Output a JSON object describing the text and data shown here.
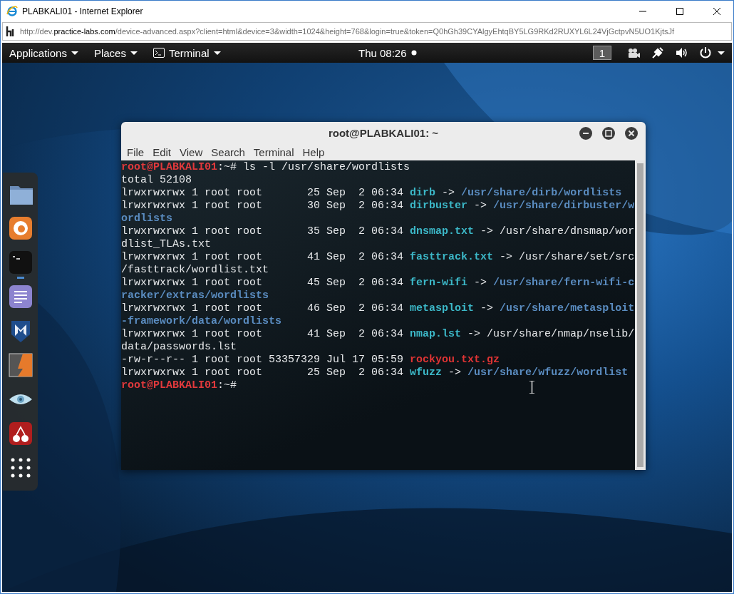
{
  "browser": {
    "title": "PLABKALI01 - Internet Explorer",
    "address": [
      {
        "text": "http://dev.",
        "kind": "dim"
      },
      {
        "text": "practice-labs.com",
        "kind": "domain"
      },
      {
        "text": "/device-advanced.aspx?client=html&device=3&width=1024&height=768&login=true&token=Q0hGh39CYAlgyEhtqBY5LG9RKd2RUXYL6L24VjGctpvN5UO1KjtsJf",
        "kind": "dim"
      }
    ]
  },
  "topbar": {
    "menus": [
      {
        "label": "Applications",
        "kind": "plain"
      },
      {
        "label": "Places",
        "kind": "plain"
      },
      {
        "label": "Terminal",
        "kind": "app"
      }
    ],
    "clock": "Thu 08:26",
    "workspace": "1"
  },
  "dock": {
    "items": [
      {
        "kind": "files",
        "running": false
      },
      {
        "kind": "browser",
        "running": false
      },
      {
        "kind": "terminal",
        "running": true
      },
      {
        "kind": "editor",
        "running": false
      },
      {
        "kind": "shield",
        "running": false
      },
      {
        "kind": "split",
        "running": false
      },
      {
        "kind": "eye",
        "running": false
      },
      {
        "kind": "cherry",
        "running": false
      },
      {
        "kind": "grid",
        "running": false
      }
    ]
  },
  "terminal": {
    "title": "root@PLABKALI01: ~",
    "menu": [
      "File",
      "Edit",
      "View",
      "Search",
      "Terminal",
      "Help"
    ],
    "lines": [
      [
        {
          "text": "root@PLABKALI01",
          "kind": "prompt"
        },
        {
          "text": ":~# ls -l /usr/share/wordlists",
          "kind": "plain"
        }
      ],
      [
        {
          "text": "total 52108",
          "kind": "plain"
        }
      ],
      [
        {
          "text": "lrwxrwxrwx 1 root root       25 Sep  2 06:34 ",
          "kind": "plain"
        },
        {
          "text": "dirb",
          "kind": "symlink"
        },
        {
          "text": " -> ",
          "kind": "plain"
        },
        {
          "text": "/usr/share/dirb/wordlists",
          "kind": "directory"
        }
      ],
      [
        {
          "text": "lrwxrwxrwx 1 root root       30 Sep  2 06:34 ",
          "kind": "plain"
        },
        {
          "text": "dirbuster",
          "kind": "symlink"
        },
        {
          "text": " -> ",
          "kind": "plain"
        },
        {
          "text": "/usr/share/dirbuster/w",
          "kind": "directory"
        }
      ],
      [
        {
          "text": "ordlists",
          "kind": "directory"
        }
      ],
      [
        {
          "text": "lrwxrwxrwx 1 root root       35 Sep  2 06:34 ",
          "kind": "plain"
        },
        {
          "text": "dnsmap.txt",
          "kind": "symlink"
        },
        {
          "text": " -> /usr/share/dnsmap/wor",
          "kind": "plain"
        }
      ],
      [
        {
          "text": "dlist_TLAs.txt",
          "kind": "plain"
        }
      ],
      [
        {
          "text": "lrwxrwxrwx 1 root root       41 Sep  2 06:34 ",
          "kind": "plain"
        },
        {
          "text": "fasttrack.txt",
          "kind": "symlink"
        },
        {
          "text": " -> /usr/share/set/src",
          "kind": "plain"
        }
      ],
      [
        {
          "text": "/fasttrack/wordlist.txt",
          "kind": "plain"
        }
      ],
      [
        {
          "text": "lrwxrwxrwx 1 root root       45 Sep  2 06:34 ",
          "kind": "plain"
        },
        {
          "text": "fern-wifi",
          "kind": "symlink"
        },
        {
          "text": " -> ",
          "kind": "plain"
        },
        {
          "text": "/usr/share/fern-wifi-c",
          "kind": "directory"
        }
      ],
      [
        {
          "text": "racker/extras/wordlists",
          "kind": "directory"
        }
      ],
      [
        {
          "text": "lrwxrwxrwx 1 root root       46 Sep  2 06:34 ",
          "kind": "plain"
        },
        {
          "text": "metasploit",
          "kind": "symlink"
        },
        {
          "text": " -> ",
          "kind": "plain"
        },
        {
          "text": "/usr/share/metasploit",
          "kind": "directory"
        }
      ],
      [
        {
          "text": "-framework/data/wordlists",
          "kind": "directory"
        }
      ],
      [
        {
          "text": "lrwxrwxrwx 1 root root       41 Sep  2 06:34 ",
          "kind": "plain"
        },
        {
          "text": "nmap.lst",
          "kind": "symlink"
        },
        {
          "text": " -> /usr/share/nmap/nselib/",
          "kind": "plain"
        }
      ],
      [
        {
          "text": "data/passwords.lst",
          "kind": "plain"
        }
      ],
      [
        {
          "text": "-rw-r--r-- 1 root root 53357329 Jul 17 05:59 ",
          "kind": "plain"
        },
        {
          "text": "rockyou.txt.gz",
          "kind": "archive"
        }
      ],
      [
        {
          "text": "lrwxrwxrwx 1 root root       25 Sep  2 06:34 ",
          "kind": "plain"
        },
        {
          "text": "wfuzz",
          "kind": "symlink"
        },
        {
          "text": " -> ",
          "kind": "plain"
        },
        {
          "text": "/usr/share/wfuzz/wordlist",
          "kind": "directory"
        }
      ],
      [
        {
          "text": "root@PLABKALI01",
          "kind": "prompt"
        },
        {
          "text": ":~#",
          "kind": "plain"
        }
      ]
    ]
  }
}
